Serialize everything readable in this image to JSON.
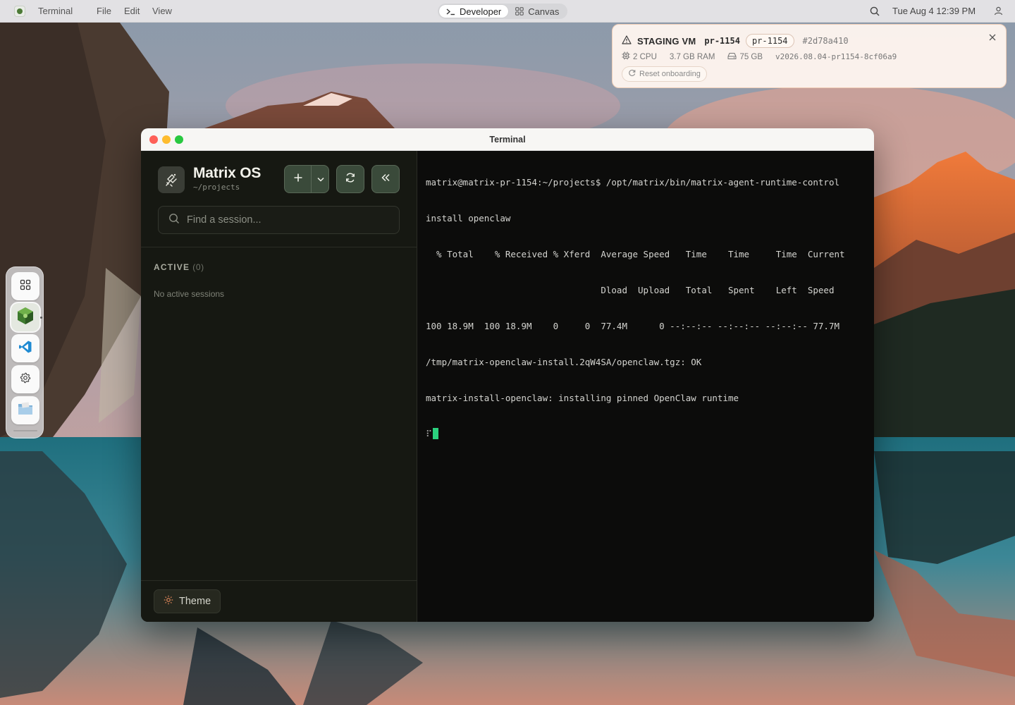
{
  "menubar": {
    "app_name": "Terminal",
    "menus": [
      "File",
      "Edit",
      "View"
    ],
    "tabs": [
      {
        "label": "Developer",
        "icon": "terminal-prompt-icon",
        "active": true
      },
      {
        "label": "Canvas",
        "icon": "grid-icon",
        "active": false
      }
    ],
    "clock": "Tue Aug 4  12:39 PM"
  },
  "notice": {
    "title": "STAGING VM",
    "branch": "pr-1154",
    "pill": "pr-1154",
    "hash": "#2d78a410",
    "cpu": "2 CPU",
    "ram": "3.7 GB RAM",
    "disk": "75 GB",
    "version": "v2026.08.04-pr1154-8cf06a9",
    "reset_label": "Reset onboarding",
    "accent": "#efcdb6"
  },
  "dock": {
    "items": [
      {
        "name": "apps-grid-icon"
      },
      {
        "name": "matrix-cube-icon",
        "active": true
      },
      {
        "name": "vscode-icon"
      },
      {
        "name": "settings-gear-icon"
      },
      {
        "name": "files-folder-icon"
      }
    ]
  },
  "window": {
    "title": "Terminal"
  },
  "sidebar": {
    "brand_title": "Matrix OS",
    "brand_path": "~/projects",
    "search_placeholder": "Find a session...",
    "section_label": "ACTIVE",
    "section_count": "(0)",
    "empty_text": "No active sessions",
    "theme_label": "Theme",
    "accent": "#3a4a3a"
  },
  "terminal": {
    "lines": [
      "matrix@matrix-pr-1154:~/projects$ /opt/matrix/bin/matrix-agent-runtime-control",
      "install openclaw",
      "  % Total    % Received % Xferd  Average Speed   Time    Time     Time  Current",
      "                                 Dload  Upload   Total   Spent    Left  Speed",
      "100 18.9M  100 18.9M    0     0  77.4M      0 --:--:-- --:--:-- --:--:-- 77.7M",
      "/tmp/matrix-openclaw-install.2qW4SA/openclaw.tgz: OK",
      "matrix-install-openclaw: installing pinned OpenClaw runtime"
    ],
    "spinner": "⠏",
    "cursor_color": "#2bd17e"
  }
}
